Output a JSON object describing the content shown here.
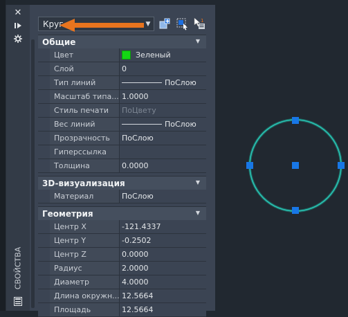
{
  "object_select": {
    "value": "Круг"
  },
  "palette_title": "СВОЙСТВА",
  "sections": [
    {
      "title": "Общие",
      "rows": [
        {
          "name": "Цвет",
          "value": "Зеленый",
          "swatch": "#14d614"
        },
        {
          "name": "Слой",
          "value": "0"
        },
        {
          "name": "Тип линий",
          "value": "ПоСлою",
          "line": true
        },
        {
          "name": "Масштаб типа...",
          "value": "1.0000"
        },
        {
          "name": "Стиль печати",
          "value": "ПоЦвету",
          "dim": true
        },
        {
          "name": "Вес линий",
          "value": "ПоСлою",
          "line": true
        },
        {
          "name": "Прозрачность",
          "value": "ПоСлою"
        },
        {
          "name": "Гиперссылка",
          "value": ""
        },
        {
          "name": "Толщина",
          "value": "0.0000"
        }
      ]
    },
    {
      "title": "3D-визуализация",
      "rows": [
        {
          "name": "Материал",
          "value": "ПоСлою"
        }
      ]
    },
    {
      "title": "Геометрия",
      "rows": [
        {
          "name": "Центр X",
          "value": "-121.4337"
        },
        {
          "name": "Центр Y",
          "value": "-0.2502"
        },
        {
          "name": "Центр Z",
          "value": "0.0000"
        },
        {
          "name": "Радиус",
          "value": "2.0000"
        },
        {
          "name": "Диаметр",
          "value": "4.0000"
        },
        {
          "name": "Длина окружн...",
          "value": "12.5664"
        },
        {
          "name": "Площадь",
          "value": "12.5664"
        }
      ]
    }
  ],
  "icons": {
    "close": "close-icon",
    "autohide": "autohide-icon",
    "settings": "properties-settings-icon",
    "quick_select": "quick-select-icon",
    "select_objects": "select-objects-icon",
    "pickadd": "pickadd-toggle-icon",
    "bottom": "properties-palette-icon"
  },
  "colors": {
    "accent_arrow": "#e8741e",
    "circle": "#29c3b3",
    "grip": "#1877e6",
    "swatch_green": "#14d614"
  }
}
